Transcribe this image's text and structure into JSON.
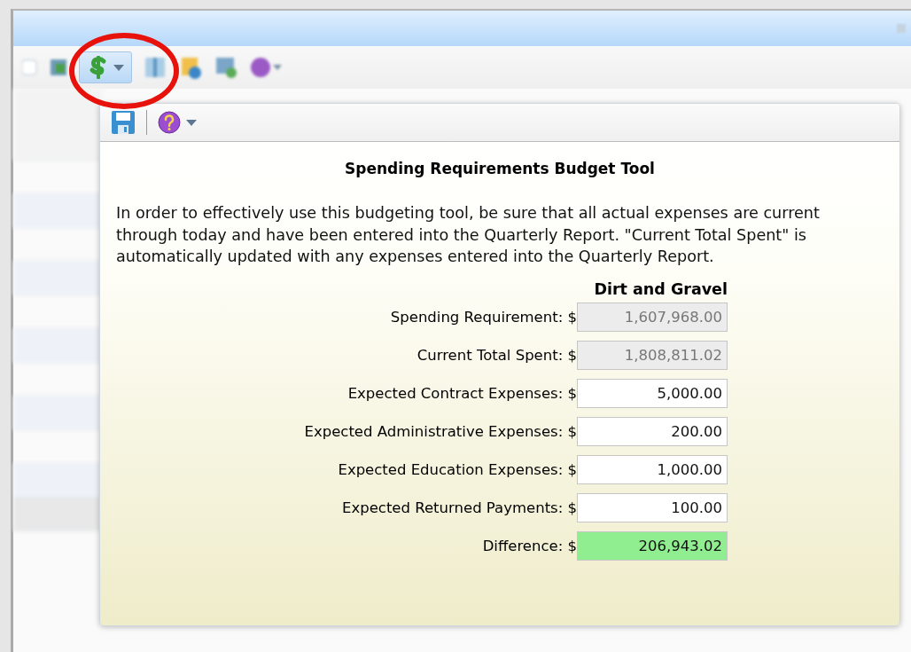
{
  "toolbar": {
    "items": [
      {
        "kind": "field",
        "selected": false
      },
      {
        "kind": "sheet",
        "selected": false
      },
      {
        "kind": "budget",
        "selected": true
      },
      {
        "kind": "report",
        "selected": false
      },
      {
        "kind": "map",
        "selected": false
      },
      {
        "kind": "export",
        "selected": false
      },
      {
        "kind": "help",
        "selected": false
      }
    ]
  },
  "budget_popup": {
    "toolbar": [
      {
        "kind": "save"
      },
      {
        "kind": "help"
      }
    ],
    "title": "Spending Requirements Budget Tool",
    "description": "In order to effectively use this budgeting tool, be sure that all actual expenses are current through today and have been entered into the Quarterly Report. \"Current Total Spent\" is automatically updated with any expenses entered into the Quarterly Report.",
    "column_header": "Dirt and Gravel",
    "rows": [
      {
        "label": "Spending Requirement:",
        "currency": "$",
        "value": "1,607,968.00",
        "kind": "readonly"
      },
      {
        "label": "Current Total Spent:",
        "currency": "$",
        "value": "1,808,811.02",
        "kind": "readonly"
      },
      {
        "label": "Expected Contract Expenses:",
        "currency": "$",
        "value": "5,000.00",
        "kind": "input"
      },
      {
        "label": "Expected Administrative Expenses:",
        "currency": "$",
        "value": "200.00",
        "kind": "input"
      },
      {
        "label": "Expected Education Expenses:",
        "currency": "$",
        "value": "1,000.00",
        "kind": "input"
      },
      {
        "label": "Expected Returned Payments:",
        "currency": "$",
        "value": "100.00",
        "kind": "input"
      },
      {
        "label": "Difference:",
        "currency": "$",
        "value": "206,943.02",
        "kind": "result"
      }
    ]
  },
  "annotation": {
    "kind": "circle",
    "color": "#e8120c"
  }
}
